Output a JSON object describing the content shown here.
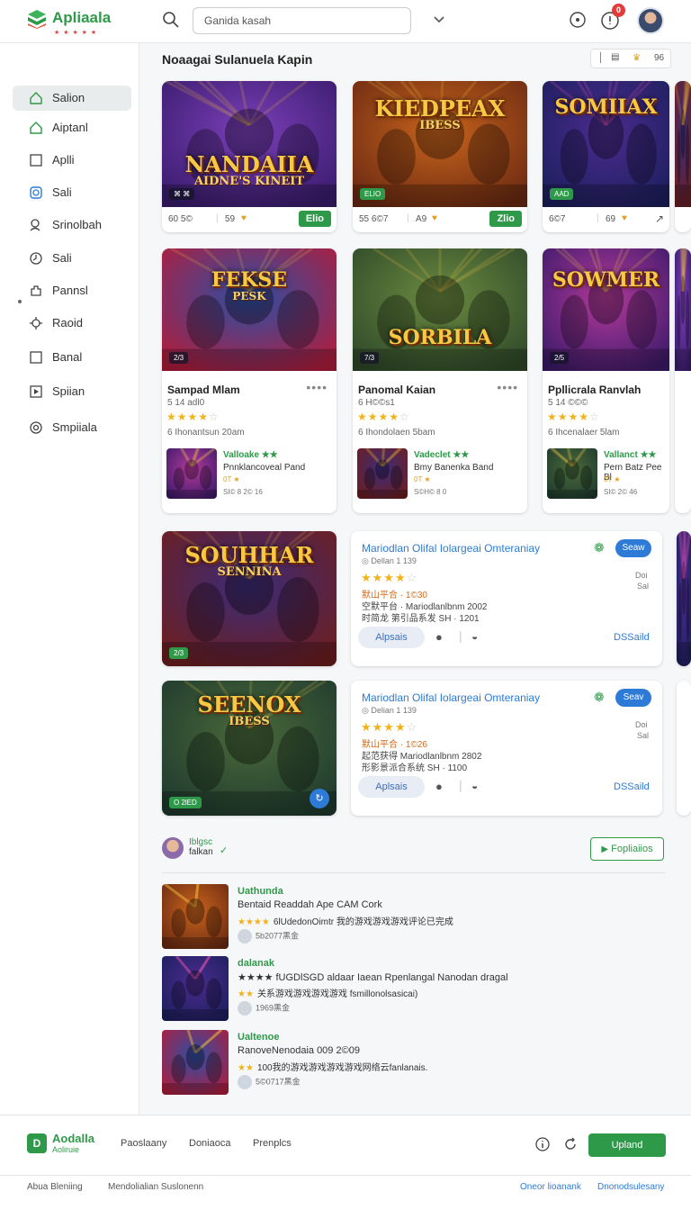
{
  "header": {
    "logo_name": "Apliaala",
    "logo_tagline": "★ ★ ★ ★ ★",
    "search_placeholder": "Ganida kasah",
    "notification_count": "0"
  },
  "sidebar": {
    "items": [
      {
        "label": "Salion",
        "icon": "home-icon"
      },
      {
        "label": "Aiptanl",
        "icon": "home-outline-icon"
      },
      {
        "label": "Aplli",
        "icon": "square-icon"
      },
      {
        "label": "Sali",
        "icon": "instagram-like-icon"
      },
      {
        "label": "Srinolbah",
        "icon": "search-person-icon"
      },
      {
        "label": "Sali",
        "icon": "clock-icon"
      },
      {
        "label": "Pannsl",
        "icon": "puzzle-icon"
      },
      {
        "label": "Raoid",
        "icon": "gear-bug-icon"
      },
      {
        "label": "Banal",
        "icon": "square-icon"
      },
      {
        "label": "Spiian",
        "icon": "play-square-icon"
      },
      {
        "label": "Smpiiala",
        "icon": "target-icon"
      }
    ]
  },
  "main": {
    "section_title": "Noaagai Sulanuela Kapin",
    "view_toggle_count": "96",
    "row1": [
      {
        "art_text": "NANDAIIA",
        "art_sub": "AIDNE'S KINEIT",
        "tag": "⌘ ⌘",
        "downloads": "60 5©",
        "likes": "59",
        "badge": "Elio"
      },
      {
        "art_text": "KIEDPEAX",
        "art_sub": "IBESS",
        "tag": "ELIO",
        "downloads": "55 6©7",
        "likes": "A9",
        "badge": "Zlio"
      },
      {
        "art_text": "SOMIIAX",
        "art_sub": "",
        "tag": "AAD",
        "downloads": "6©7",
        "likes": "69",
        "badge": ""
      }
    ],
    "row2": [
      {
        "art_text": "FEKSE",
        "art_sub": "PESK",
        "tag": "2/3",
        "title": "Sampad Mlam",
        "meta": "5 14 adl0",
        "reviews": "6 Ihonantsun 20am",
        "rating": 4,
        "sub_title": "Valloake ★★",
        "sub_line": "Pnnklancoveal Pand",
        "sub_rating": "0T ★",
        "sub_small": "SI© 8 2© 16"
      },
      {
        "art_text": "SORBILA",
        "art_sub": "",
        "tag": "7/3",
        "title": "Panomal Kaian",
        "meta": "6 H©©s1",
        "reviews": "6 Ihondolaen 5bam",
        "rating": 4,
        "sub_title": "Vadeclet ★★",
        "sub_line": "Bmy Banenka Band",
        "sub_rating": "0T ★",
        "sub_small": "S©H© 8 0"
      },
      {
        "art_text": "SOWMER",
        "art_sub": "",
        "tag": "2/5",
        "title": "Ppllicrala Ranvlah",
        "meta": "5 14 ©©©",
        "reviews": "6 Ihcenalaer 5lam",
        "rating": 4,
        "sub_title": "Vallanct ★★",
        "sub_line": "Pern Batz Pee Bl",
        "sub_rating": "0T ★",
        "sub_small": "SI© 2© 46"
      }
    ],
    "feature_cards": [
      {
        "art_text": "SOUHHAR",
        "art_sub": "SENNINA",
        "tag": "2/3"
      },
      {
        "art_text": "SEENOX",
        "art_sub": "IBESS",
        "tag": "O 2lED"
      }
    ],
    "detail_cards": [
      {
        "title": "Mariodlan Olifal Iolargeai Omteraniay",
        "sub": "◎ Dellan 1 139",
        "rating": 4,
        "line1": "默山平合 · 1©30",
        "line2": "空默平台 · Mariodlanlbnm 2002",
        "line3": "时简龙 第引品系发 SH · 1201",
        "save": "Seaw",
        "right1": "Doi",
        "right2": "Sal",
        "pill": "Alpsais",
        "link": "DSSaild"
      },
      {
        "title": "Mariodlan Olifal Iolargeai Omteraniay",
        "sub": "◎ Delian 1 139",
        "rating": 4,
        "line1": "默山平合 · 1©26",
        "line2": "起范获得 Mariodlanlbnm 2802",
        "line3": "形影景派合系统 SH · 1100",
        "save": "Seav",
        "right1": "Doi",
        "right2": "Sal",
        "pill": "Aplsais",
        "link": "DSSaild"
      }
    ],
    "reviews_header": {
      "user": "Iblgsc",
      "sub": "falkan",
      "button": "Fopliaiios"
    },
    "reviews": [
      {
        "title": "Uathunda",
        "line": "Bentaid Readdah Ape CAM Cork",
        "stars": "★★★★",
        "star_text": "6lUdedonOimtr 我的游戏游戏游戏评论已完成",
        "meta": "5b2077黑金"
      },
      {
        "title": "dalanak",
        "line": "★★★★ fUGDlSGD aldaar Iaean Rpenlangal Nanodan dragal",
        "stars": "★★",
        "star_text": "关系游戏游戏游戏游戏 fsmillonolsasicai)",
        "meta": "1969黑金"
      },
      {
        "title": "Ualtenoe",
        "line": "RanoveNenodaia 009 2©09",
        "stars": "★★",
        "star_text": "100我的游戏游戏游戏游戏网络云fanlanais.",
        "meta": "5©0717黑金"
      }
    ]
  },
  "footer": {
    "brand": "Aodalla",
    "brand_sub": "Aoliruie",
    "links": [
      "Paoslaany",
      "Doniaoca",
      "Prenplcs"
    ],
    "upload_button": "Upland",
    "bottom_left": [
      "Abua Bleniing",
      "Mendolialian Suslonenn"
    ],
    "bottom_right": [
      "Oneor lioanank",
      "Dnonodsulesany"
    ]
  },
  "colors": {
    "brand_green": "#2e9a49",
    "link_blue": "#2d7bd6",
    "star": "#f1b21b",
    "alert_red": "#e23b3b"
  }
}
